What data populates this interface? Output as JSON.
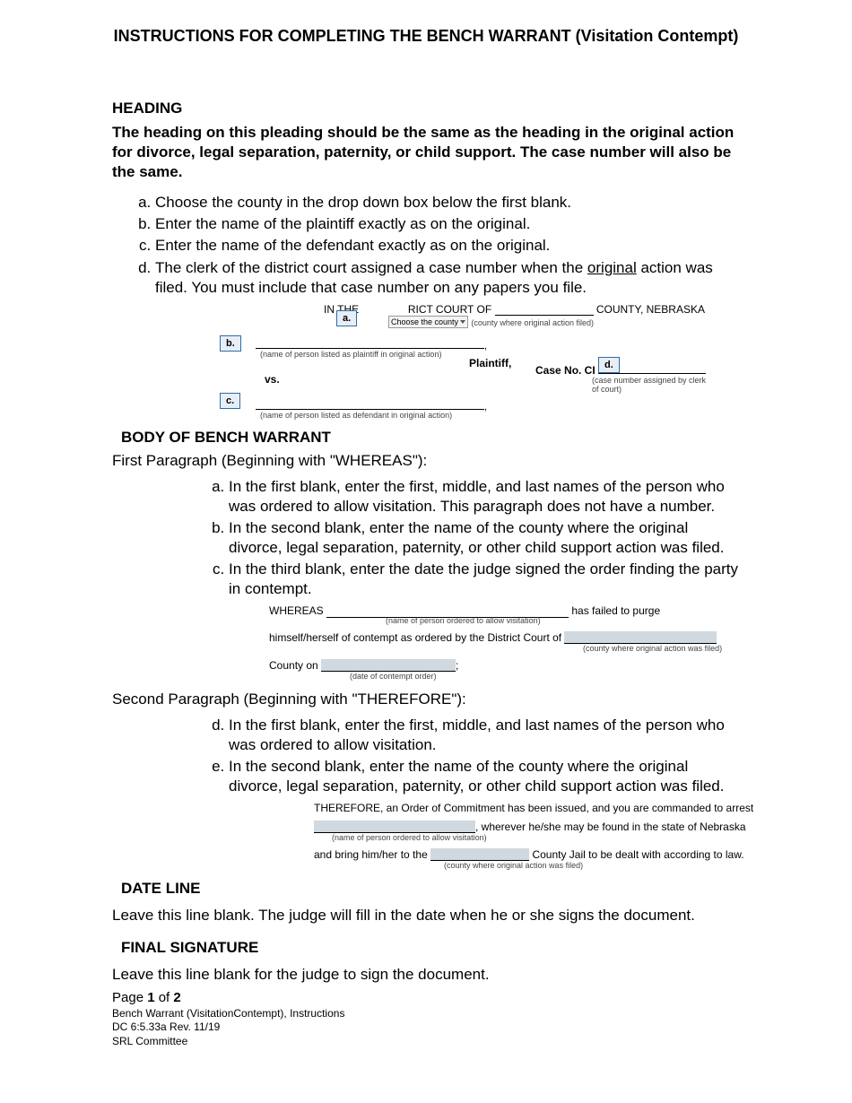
{
  "title": "INSTRUCTIONS FOR COMPLETING THE BENCH WARRANT (Visitation Contempt)",
  "heading": {
    "label": "HEADING",
    "intro": "The heading on this pleading should be the same as the heading in the original action for divorce, legal separation, paternity, or child support. The case number will also be the same.",
    "items": {
      "a": "Choose the county in the drop down box below the first blank.",
      "b": "Enter the name of the plaintiff exactly as on the original.",
      "c": "Enter the name of the defendant exactly as on the original.",
      "d_pre": "The clerk of the district court assigned a case number when the ",
      "d_underline": "original",
      "d_post": " action was filed. You must include that case number on any papers you file."
    }
  },
  "diagram1": {
    "in_the": "IN THE",
    "court_of": "RICT COURT OF",
    "county_ne": "COUNTY, NEBRASKA",
    "choose_county": "Choose the county",
    "county_filed": "(county where original  action filed)",
    "call_a": "a.",
    "call_b": "b.",
    "call_c": "c.",
    "call_d": "d.",
    "plaintiff_label": "(name of person listed as plaintiff in original action)",
    "plaintiff_word": "Plaintiff,",
    "vs": "vs.",
    "case_no": "Case No. CI",
    "case_label": "(case number assigned by clerk of court)",
    "def_label": "(name of person listed as defendant in original action)"
  },
  "body": {
    "label": "BODY OF BENCH WARRANT",
    "first_intro": "First Paragraph (Beginning with \"WHEREAS\"):",
    "first": {
      "a": "In the first blank, enter the first, middle, and last names of the person who was ordered to allow visitation. This paragraph does not have a number.",
      "b": "In the second blank, enter the name of the county where the original divorce, legal separation, paternity, or other child support action was filed.",
      "c": "In the third blank, enter the date the judge signed the order finding the party in contempt."
    },
    "second_intro": "Second Paragraph (Beginning with \"THEREFORE\"):",
    "second": {
      "d": "In the first blank, enter the first, middle, and last names of the person who was ordered to allow visitation.",
      "e": "In the second blank, enter the name of the county where the original divorce, legal separation, paternity, or other child support action was filed."
    }
  },
  "diagram2": {
    "whereas": "WHEREAS",
    "has_failed": "has failed to purge",
    "name_label": "(name of person ordered to allow visitation)",
    "himself": "himself/herself of contempt as ordered by the District Court of",
    "county_label": "(county where original action was filed)",
    "county_on": "County on",
    "date_label": "(date of contempt order)"
  },
  "diagram3": {
    "therefore": "THEREFORE, an Order of Commitment has been issued, and you are commanded to arrest",
    "wherever": ", wherever he/she may be found in the state of Nebraska",
    "name_label": "(name of person ordered to allow visitation)",
    "bring": "and bring him/her to the",
    "jail": "County Jail to be dealt with according to law.",
    "county_label": "(county where original action was filed)"
  },
  "date_line": {
    "label": "DATE LINE",
    "text": "Leave this line blank. The judge will fill in the date when he or she signs the document."
  },
  "final_sig": {
    "label": "FINAL SIGNATURE",
    "text": "Leave this line blank for the judge to sign the document."
  },
  "footer": {
    "page_pre": "Page ",
    "page_num": "1",
    "page_mid": " of ",
    "page_total": "2",
    "line1": "Bench Warrant (VisitationContempt), Instructions",
    "line2": "DC 6:5.33a Rev. 11/19",
    "line3": "SRL Committee"
  }
}
